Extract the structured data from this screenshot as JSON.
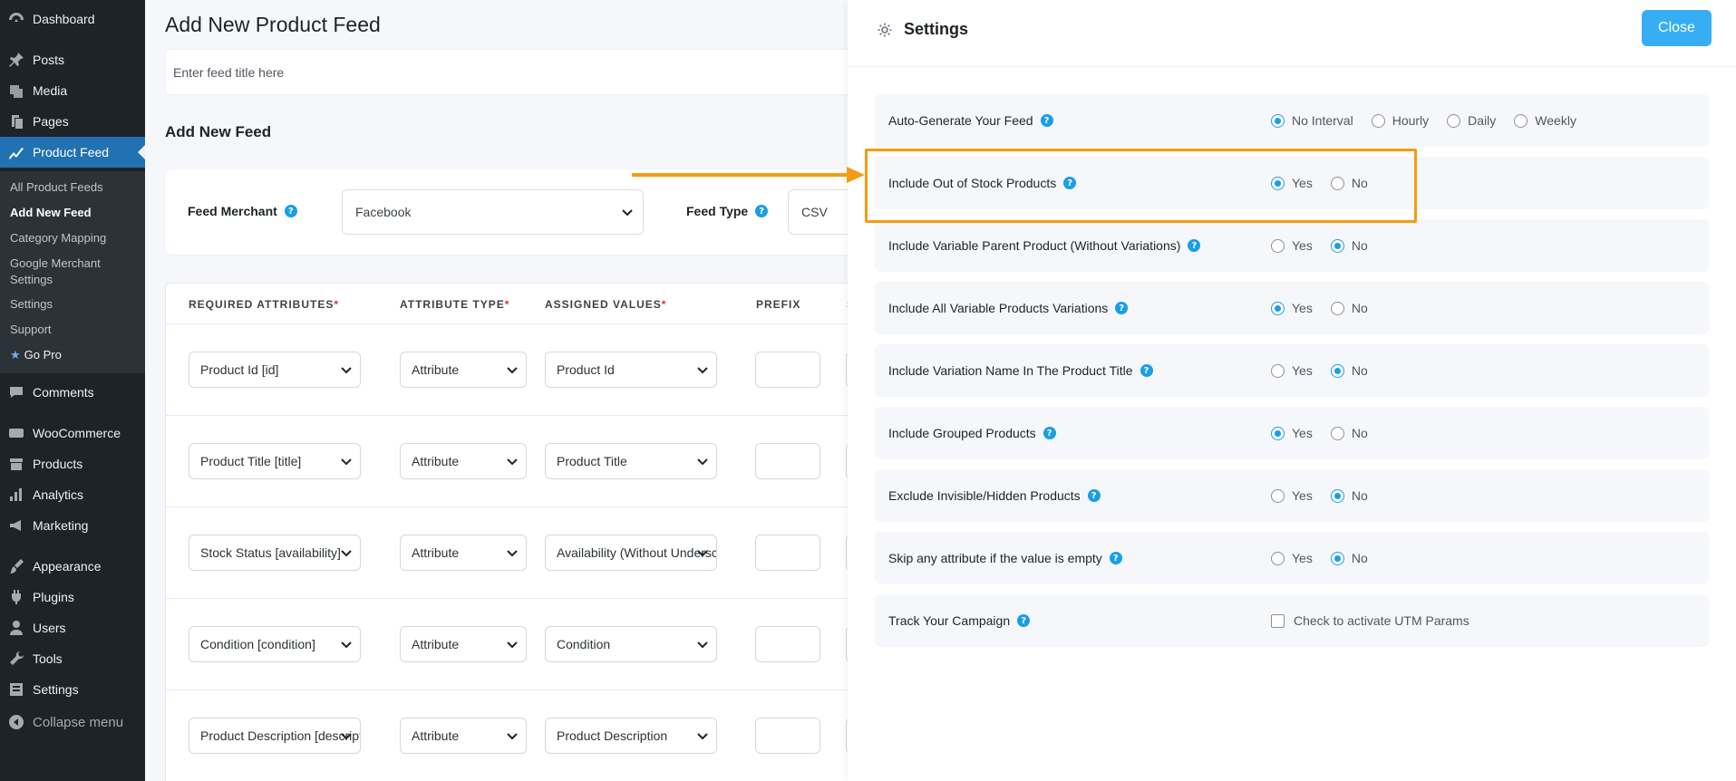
{
  "sidebar": {
    "menu": [
      {
        "label": "Dashboard",
        "icon": "dashboard-icon"
      },
      {
        "label": "Posts",
        "icon": "pin-icon"
      },
      {
        "label": "Media",
        "icon": "media-icon"
      },
      {
        "label": "Pages",
        "icon": "pages-icon"
      },
      {
        "label": "Product Feed",
        "icon": "chart-line-icon"
      },
      {
        "label": "Comments",
        "icon": "comment-icon"
      },
      {
        "label": "WooCommerce",
        "icon": "woo-icon"
      },
      {
        "label": "Products",
        "icon": "archive-icon"
      },
      {
        "label": "Analytics",
        "icon": "bar-chart-icon"
      },
      {
        "label": "Marketing",
        "icon": "megaphone-icon"
      },
      {
        "label": "Appearance",
        "icon": "brush-icon"
      },
      {
        "label": "Plugins",
        "icon": "plugin-icon"
      },
      {
        "label": "Users",
        "icon": "user-icon"
      },
      {
        "label": "Tools",
        "icon": "wrench-icon"
      },
      {
        "label": "Settings",
        "icon": "settings-icon"
      }
    ],
    "submenu": [
      "All Product Feeds",
      "Add New Feed",
      "Category Mapping",
      "Google Merchant",
      "Settings",
      "Support",
      "Go Pro"
    ],
    "submenu_line2": "Settings",
    "collapse": "Collapse menu"
  },
  "main": {
    "page_title": "Add New Product Feed",
    "title_placeholder": "Enter feed title here",
    "section_title": "Add New Feed",
    "feed_merchant_label": "Feed Merchant",
    "feed_merchant_value": "Facebook",
    "feed_type_label": "Feed Type",
    "feed_type_value": "CSV",
    "table_headers": {
      "required": "REQUIRED ATTRIBUTES",
      "type": "ATTRIBUTE TYPE",
      "assigned": "ASSIGNED VALUES",
      "prefix": "PREFIX",
      "suffix": "S",
      "required_mark": "*"
    },
    "rows": [
      {
        "attribute": "Product Id [id]",
        "type": "Attribute",
        "value": "Product Id"
      },
      {
        "attribute": "Product Title [title]",
        "type": "Attribute",
        "value": "Product Title"
      },
      {
        "attribute": "Stock Status [availability]",
        "type": "Attribute",
        "value": "Availability (Without Underscore)"
      },
      {
        "attribute": "Condition [condition]",
        "type": "Attribute",
        "value": "Condition"
      },
      {
        "attribute": "Product Description [description]",
        "type": "Attribute",
        "value": "Product Description"
      }
    ]
  },
  "drawer": {
    "title": "Settings",
    "close_label": "Close",
    "settings": [
      {
        "label": "Auto-Generate Your Feed",
        "options": [
          "No Interval",
          "Hourly",
          "Daily",
          "Weekly"
        ],
        "selected": "No Interval"
      },
      {
        "label": "Include Out of Stock Products",
        "options": [
          "Yes",
          "No"
        ],
        "selected": "Yes"
      },
      {
        "label": "Include Variable Parent Product (Without Variations)",
        "options": [
          "Yes",
          "No"
        ],
        "selected": "No"
      },
      {
        "label": "Include All Variable Products Variations",
        "options": [
          "Yes",
          "No"
        ],
        "selected": "Yes"
      },
      {
        "label": "Include Variation Name In The Product Title",
        "options": [
          "Yes",
          "No"
        ],
        "selected": "No"
      },
      {
        "label": "Include Grouped Products",
        "options": [
          "Yes",
          "No"
        ],
        "selected": "Yes"
      },
      {
        "label": "Exclude Invisible/Hidden Products",
        "options": [
          "Yes",
          "No"
        ],
        "selected": "No"
      },
      {
        "label": "Skip any attribute if the value is empty",
        "options": [
          "Yes",
          "No"
        ],
        "selected": "No"
      }
    ],
    "track": {
      "label": "Track Your Campaign",
      "checkbox_label": "Check to activate UTM Params",
      "checked": false
    }
  },
  "colors": {
    "accent": "#1a9ee8",
    "annotation": "#f39c12",
    "sidebar_bg": "#1d2327",
    "active_menu": "#2271b1"
  }
}
